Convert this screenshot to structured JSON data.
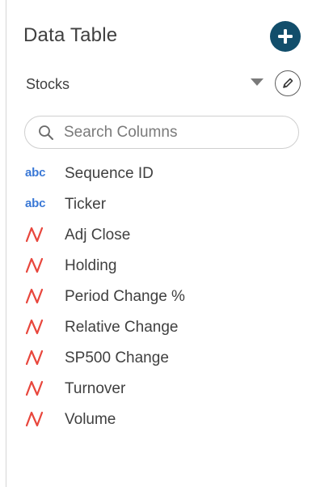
{
  "panel": {
    "title": "Data Table",
    "add_button_icon": "plus-icon"
  },
  "source": {
    "selected": "Stocks",
    "dropdown_icon": "caret-down-icon",
    "edit_icon": "pencil-icon"
  },
  "search": {
    "placeholder": "Search Columns",
    "value": "",
    "icon": "search-icon"
  },
  "columns": [
    {
      "name": "Sequence ID",
      "type": "text",
      "type_label": "abc"
    },
    {
      "name": "Ticker",
      "type": "text",
      "type_label": "abc"
    },
    {
      "name": "Adj Close",
      "type": "numeric"
    },
    {
      "name": "Holding",
      "type": "numeric"
    },
    {
      "name": "Period Change %",
      "type": "numeric"
    },
    {
      "name": "Relative Change",
      "type": "numeric"
    },
    {
      "name": "SP500 Change",
      "type": "numeric"
    },
    {
      "name": "Turnover",
      "type": "numeric"
    },
    {
      "name": "Volume",
      "type": "numeric"
    }
  ],
  "colors": {
    "accent": "#124e6b",
    "text_type": "#3a78d6",
    "numeric_type": "#e8463c",
    "label": "#404040"
  }
}
